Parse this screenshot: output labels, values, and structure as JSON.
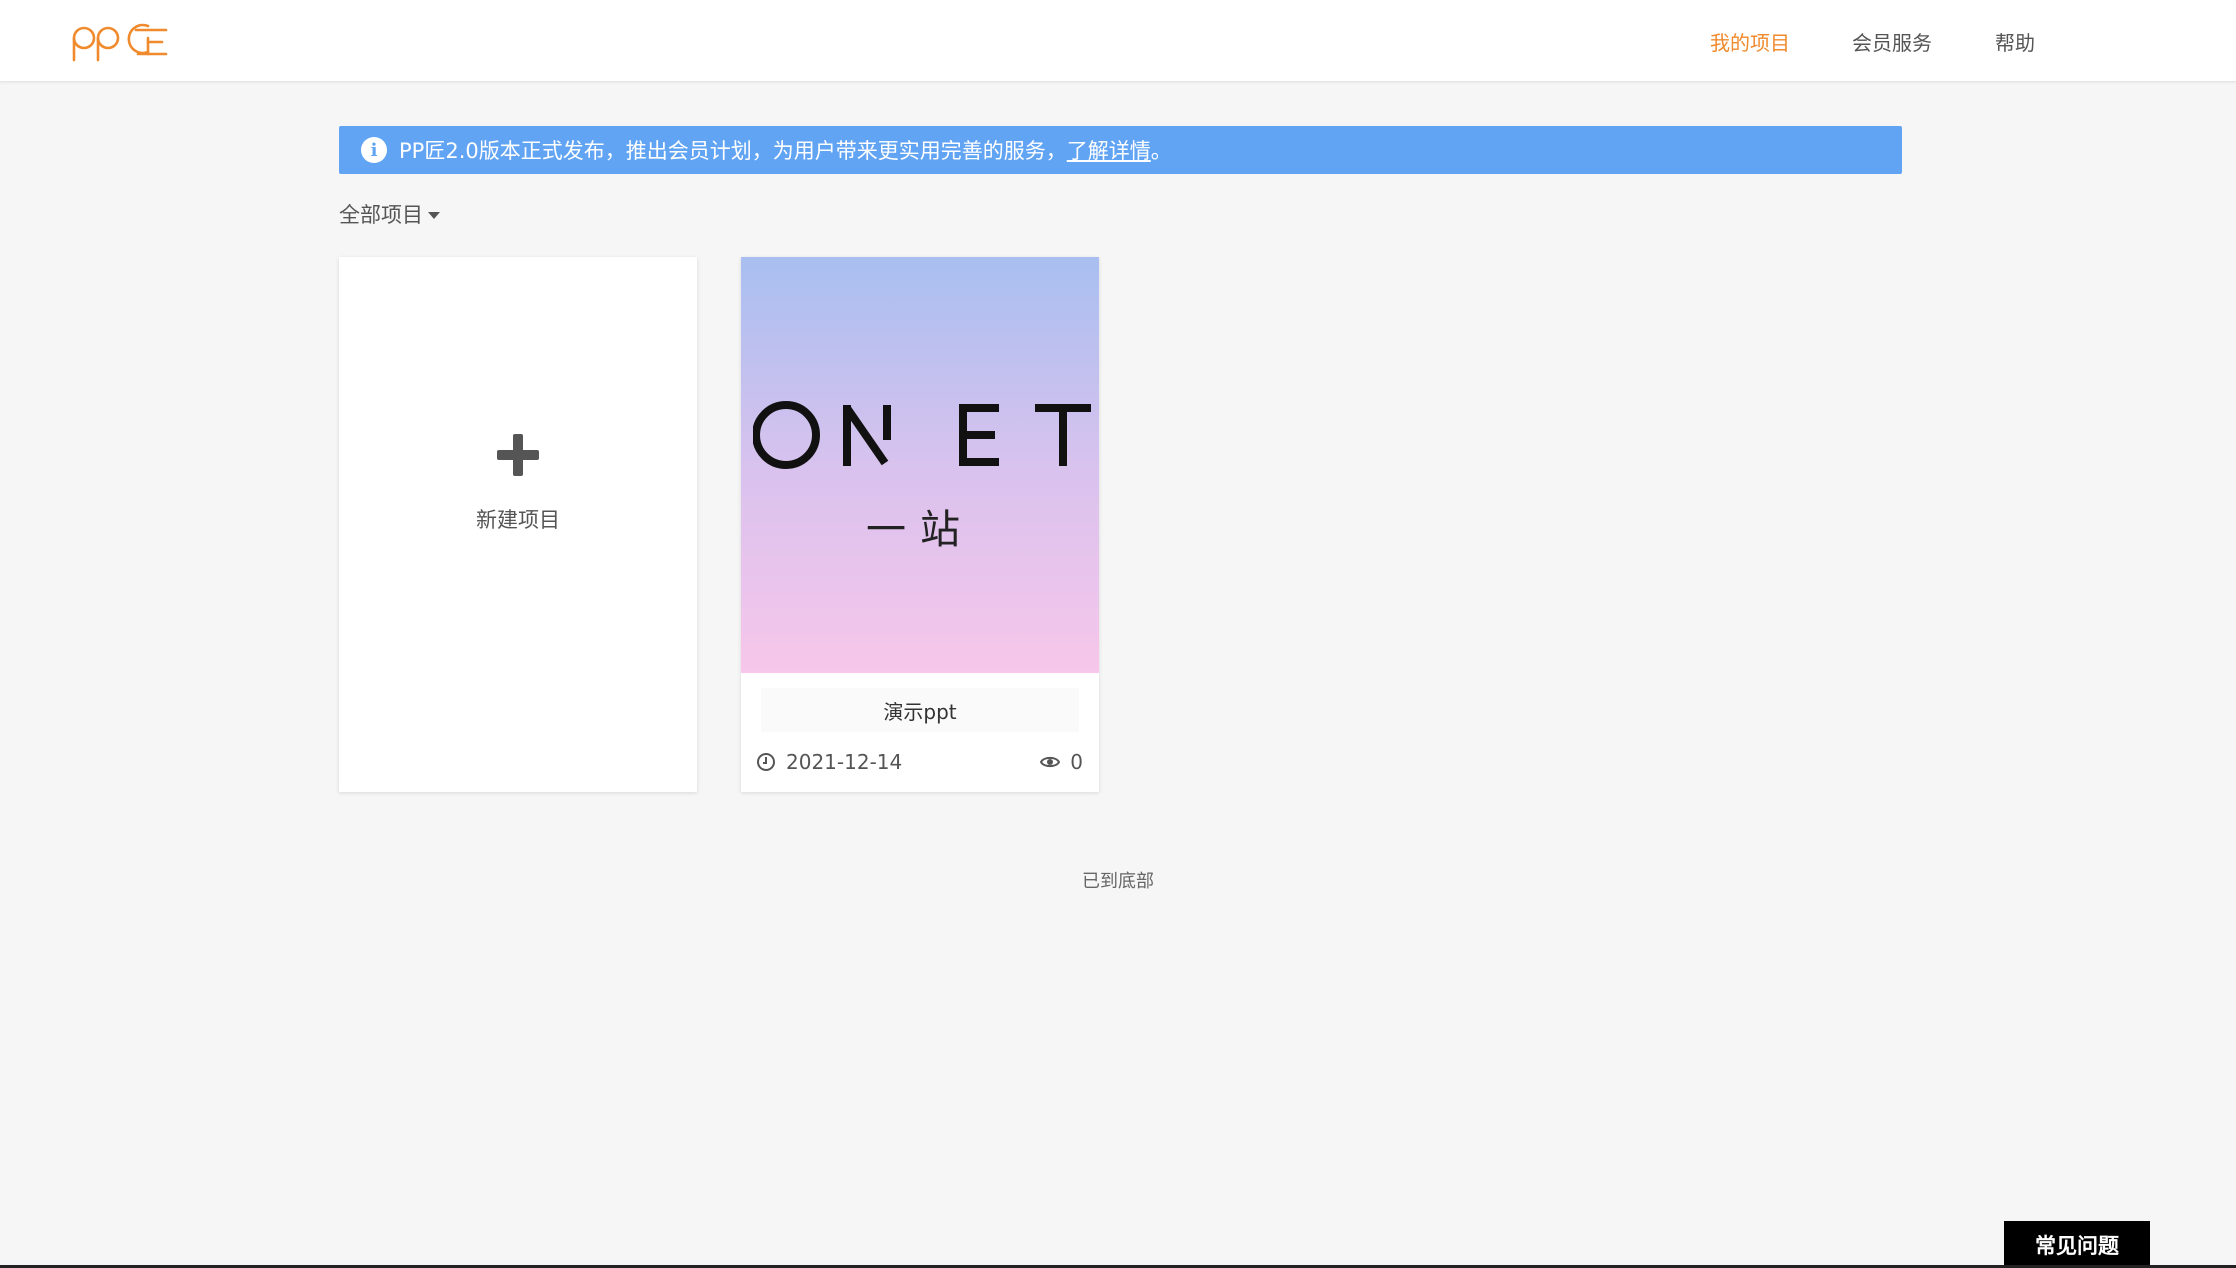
{
  "header": {
    "nav": {
      "my_projects": "我的项目",
      "member_service": "会员服务",
      "help": "帮助"
    }
  },
  "notice": {
    "text": "PP匠2.0版本正式发布，推出会员计划，为用户带来更实用完善的服务，",
    "link": "了解详情",
    "tail": "。"
  },
  "filter": {
    "label": "全部项目"
  },
  "new_project": {
    "label": "新建项目"
  },
  "projects": [
    {
      "thumb_title": "ONET",
      "thumb_subtitle": "一站",
      "name": "演示ppt",
      "date": "2021-12-14",
      "views": "0"
    }
  ],
  "footer": {
    "end_note": "已到底部",
    "faq": "常见问题"
  },
  "colors": {
    "brand": "#f08a2d",
    "notice_bg": "#62a4f4",
    "background": "#f6f6f6"
  },
  "icons": {
    "info": "info-icon",
    "clock": "clock-icon",
    "eye": "eye-icon",
    "plus": "plus-icon",
    "caret": "caret-down-icon"
  }
}
